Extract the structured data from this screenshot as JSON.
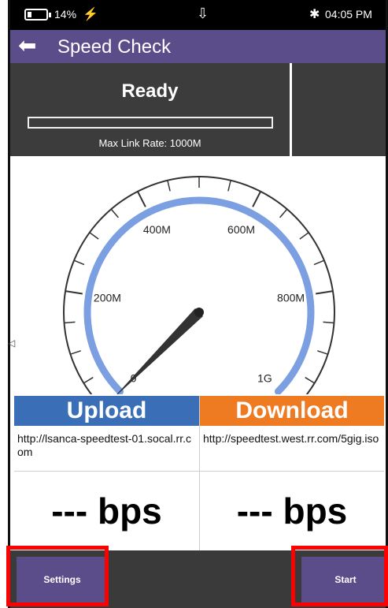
{
  "status_bar": {
    "battery_pct": "14%",
    "time": "04:05 PM",
    "icons": [
      "battery-icon",
      "charging-icon",
      "usb-icon",
      "bluetooth-icon"
    ]
  },
  "title_bar": {
    "title": "Speed Check",
    "back_icon": "back-arrow-icon"
  },
  "status_panel": {
    "state": "Ready",
    "progress": 0,
    "max_link_rate": "Max Link Rate: 1000M"
  },
  "gauge": {
    "labels": [
      "0",
      "200M",
      "400M",
      "600M",
      "800M",
      "1G"
    ],
    "needle_value": 0
  },
  "upload": {
    "label": "Upload",
    "url": "http://lsanca-speedtest-01.socal.rr.com",
    "speed": "--- bps",
    "color": "#3a6fb8"
  },
  "download": {
    "label": "Download",
    "url": "http://speedtest.west.rr.com/5gig.iso",
    "speed": "--- bps",
    "color": "#ee7b22"
  },
  "bottom_bar": {
    "settings_label": "Settings",
    "start_label": "Start"
  },
  "colors": {
    "accent": "#5b4c8a",
    "highlight": "#ff0000",
    "gauge_arc": "#7b9fe0"
  }
}
